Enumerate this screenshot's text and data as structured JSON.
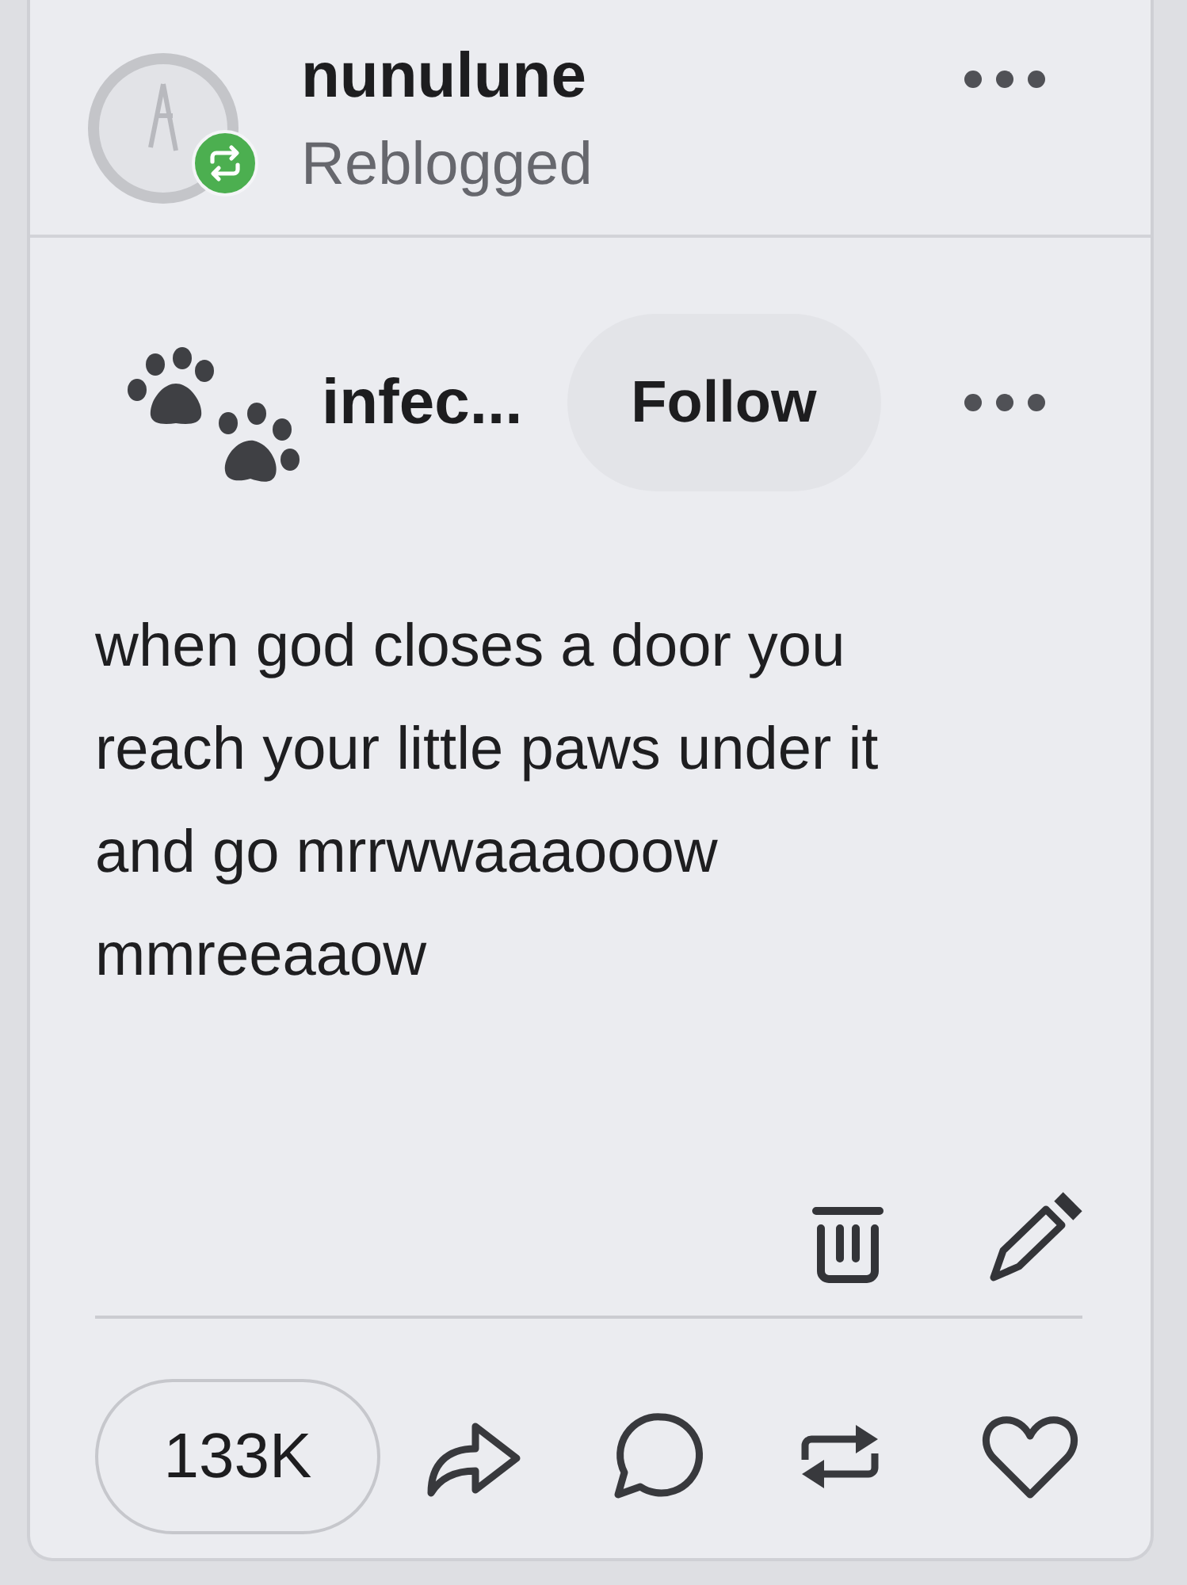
{
  "reblog_header": {
    "blog_name": "nunulune",
    "status": "Reblogged"
  },
  "post": {
    "author": "infec...",
    "follow_button": "Follow",
    "text": "when god closes a door you\nreach your little paws under it\nand go mrrwwaaaooow\nmmreeaaow"
  },
  "footer": {
    "note_count": "133K"
  }
}
